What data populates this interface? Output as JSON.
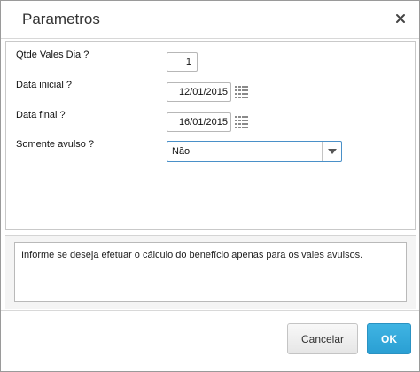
{
  "dialog": {
    "title": "Parametros",
    "close_icon": "close-icon"
  },
  "params": {
    "qtde_vales": {
      "label": "Qtde Vales Dia ?",
      "value": "1"
    },
    "data_inicial": {
      "label": "Data inicial ?",
      "value": "12/01/2015",
      "icon": "calendar-icon"
    },
    "data_final": {
      "label": "Data final ?",
      "value": "16/01/2015",
      "icon": "calendar-icon"
    },
    "somente_avulso": {
      "label": "Somente avulso ?",
      "value": "Não",
      "icon": "chevron-down-icon"
    }
  },
  "help": {
    "text": "Informe se deseja efetuar o cálculo do benefício apenas para os vales avulsos."
  },
  "footer": {
    "cancel_label": "Cancelar",
    "ok_label": "OK",
    "ok_color": "#2a9fd3"
  }
}
